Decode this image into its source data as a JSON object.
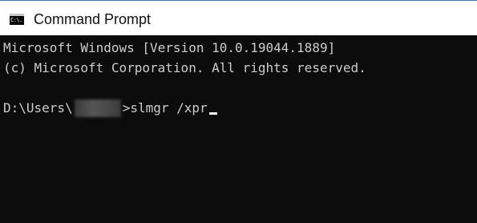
{
  "window": {
    "title": "Command Prompt",
    "icon": "cmd-icon",
    "icon_text": "C:\\."
  },
  "console": {
    "lines": [
      "Microsoft Windows [Version 10.0.19044.1889]",
      "(c) Microsoft Corporation. All rights reserved."
    ],
    "prompt_prefix": "D:\\Users\\",
    "prompt_suffix": ">",
    "command": "slmgr /xpr"
  },
  "colors": {
    "background": "#0c0c0c",
    "text": "#cccccc",
    "titlebar": "#ffffff"
  }
}
